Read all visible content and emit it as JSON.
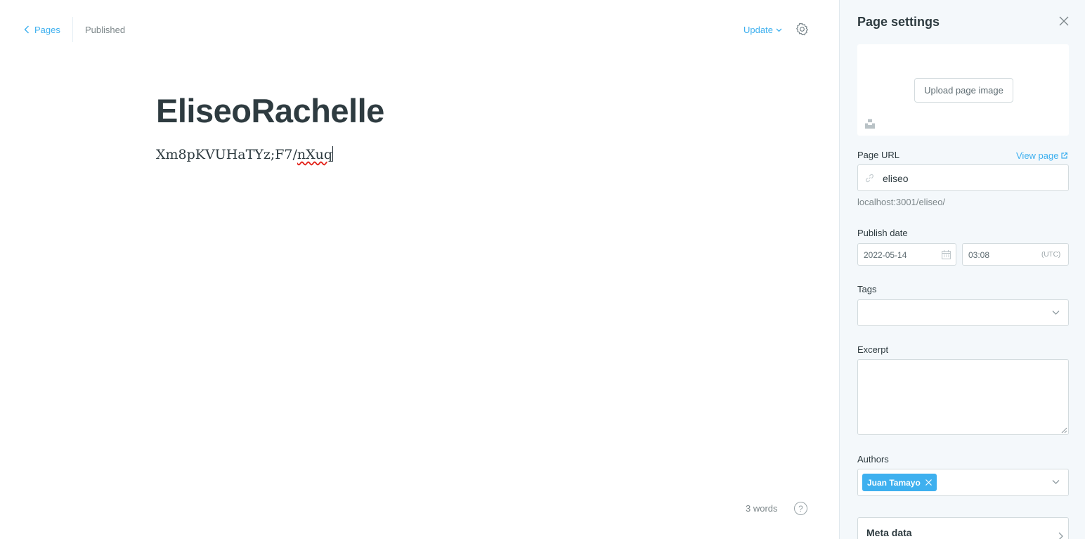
{
  "header": {
    "back_label": "Pages",
    "status": "Published",
    "update_label": "Update"
  },
  "post": {
    "title": "EliseoRachelle",
    "body_plain": "Xm8pKVUHaTYz;F7/",
    "body_misspelled": "nXuq",
    "word_count": "3 words"
  },
  "icons": {
    "back": "chevron-left-icon",
    "settings": "gear-icon",
    "help": "question-circle-icon",
    "close": "close-icon",
    "unsplash": "unsplash-icon",
    "link": "link-icon",
    "calendar": "calendar-icon",
    "external": "external-link-icon"
  },
  "help_glyph": "?",
  "panel": {
    "title": "Page settings",
    "upload_label": "Upload page image",
    "url_label": "Page URL",
    "view_page_label": "View page",
    "url_value": "eliseo",
    "url_preview": "localhost:3001/eliseo/",
    "publish_date_label": "Publish date",
    "date_value": "2022-05-14",
    "time_value": "03:08",
    "timezone": "(UTC)",
    "tags_label": "Tags",
    "excerpt_label": "Excerpt",
    "authors_label": "Authors",
    "authors": [
      "Juan Tamayo"
    ],
    "meta_label": "Meta data"
  },
  "colors": {
    "accent": "#3eb0ef",
    "panel_bg": "#f4f8fb",
    "text": "#2e3b40",
    "muted": "#7d878a",
    "border": "#d3dbde",
    "spell_error": "#e2231a"
  }
}
